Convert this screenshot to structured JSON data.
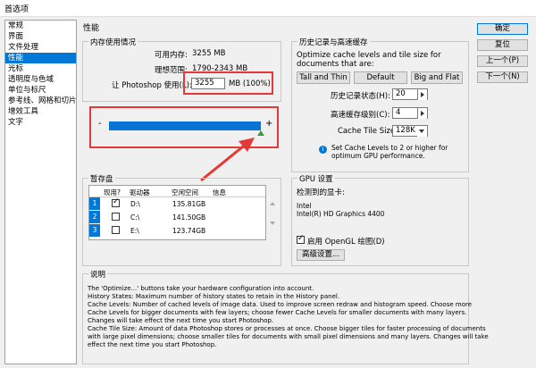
{
  "window": {
    "title": "首选项"
  },
  "nav": {
    "items": [
      "常规",
      "界面",
      "文件处理",
      "性能",
      "光标",
      "透明度与色域",
      "单位与标尺",
      "参考线、网格和切片",
      "增效工具",
      "文字"
    ],
    "selected_index": 3
  },
  "section_title": "性能",
  "memory": {
    "legend": "内存使用情况",
    "available_label": "可用内存:",
    "available_value": "3255 MB",
    "ideal_label": "理想范围:",
    "ideal_value": "1790-2343 MB",
    "use_label": "让 Photoshop 使用(L):",
    "use_value": "3255",
    "use_unit": "MB (100%)",
    "slider_minus": "-",
    "slider_plus": "+",
    "slider_fraction": 1.0
  },
  "history": {
    "legend": "历史记录与高速缓存",
    "desc": "Optimize cache levels and tile size for documents that are:",
    "buttons": [
      "Tall and Thin",
      "Default",
      "Big and Flat"
    ],
    "states_label": "历史记录状态(H):",
    "states_value": "20",
    "cache_levels_label": "高速缓存级别(C):",
    "cache_levels_value": "4",
    "tile_label": "Cache Tile Size:",
    "tile_value": "128K",
    "hint": "Set Cache Levels to 2 or higher for optimum GPU performance.",
    "accent": "#0078d7"
  },
  "scratch": {
    "legend": "暂存盘",
    "headers": [
      "现用?",
      "驱动器",
      "空闲空间",
      "信息"
    ],
    "rows": [
      {
        "index": "1",
        "active": true,
        "drive": "D:\\",
        "free": "135.81GB",
        "info": ""
      },
      {
        "index": "2",
        "active": false,
        "drive": "C:\\",
        "free": "141.50GB",
        "info": ""
      },
      {
        "index": "3",
        "active": false,
        "drive": "E:\\",
        "free": "123.74GB",
        "info": ""
      }
    ]
  },
  "gpu": {
    "legend": "GPU 设置",
    "detected_label": "检测到的显卡:",
    "card_line1": "Intel",
    "card_line2": "Intel(R) HD Graphics 4400",
    "opengl_label": "启用 OpenGL 绘图(D)",
    "opengl_checked": true,
    "advanced_button": "高级设置..."
  },
  "desc": {
    "legend": "说明",
    "lines": [
      "The 'Optimize...' buttons take your hardware configuration into account.",
      "History States: Maximum number of history states to retain in the History panel.",
      "Cache Levels: Number of cached levels of image data.  Used to improve screen redraw and histogram speed.  Choose more",
      "Cache Levels for bigger documents with few layers; choose fewer Cache Levels for smaller documents with many layers.",
      "Changes will take effect the next time you start Photoshop.",
      "Cache Tile Size: Amount of data Photoshop stores or processes at once. Choose bigger tiles for faster processing of documents",
      "with large pixel dimensions; choose smaller tiles for documents with small pixel dimensions and many layers. Changes will take",
      "effect the next time you start Photoshop."
    ]
  },
  "actions": {
    "ok": "确定",
    "reset": "复位",
    "prev": "上一个(P)",
    "next": "下一个(N)"
  },
  "colors": {
    "highlight": "#e53935",
    "selection": "#0078d7",
    "bar": "#0a74d4"
  }
}
